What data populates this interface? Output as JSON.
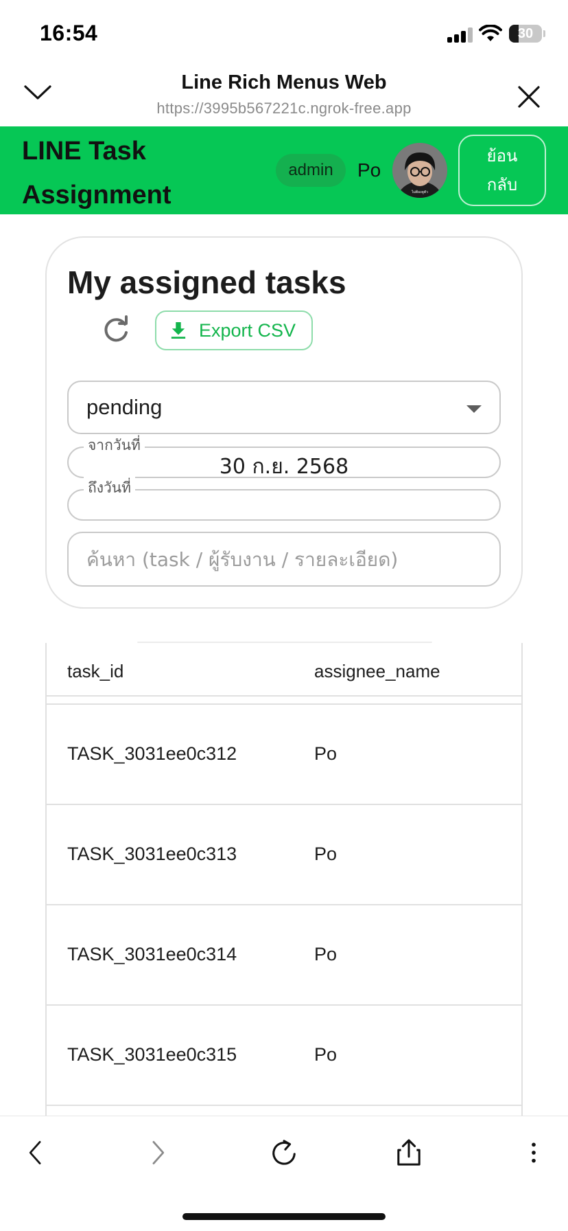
{
  "status_bar": {
    "time": "16:54",
    "battery_level": "30"
  },
  "browser": {
    "title": "Line Rich Menus Web",
    "url": "https://3995b567221c.ngrok-free.app"
  },
  "app_bar": {
    "title": "LINE Task Assignment",
    "role": "admin",
    "user_name": "Po",
    "avatar_caption": "ไม่ต้องดูตัว",
    "back_label": "ย้อนกลับ",
    "brand_color": "#06c755"
  },
  "filters": {
    "heading": "My assigned tasks",
    "export_label": "Export CSV",
    "status_value": "pending",
    "from_date_label": "จากวันที่",
    "from_date_value": "30 ก.ย. 2568",
    "to_date_label": "ถึงวันที่",
    "to_date_value": "",
    "search_placeholder": "ค้นหา (task / ผู้รับงาน / รายละเอียด)"
  },
  "table": {
    "columns": [
      "task_id",
      "assignee_name"
    ],
    "rows": [
      [
        "TASK_3031ee0c312",
        "Po"
      ],
      [
        "TASK_3031ee0c313",
        "Po"
      ],
      [
        "TASK_3031ee0c314",
        "Po"
      ],
      [
        "TASK_3031ee0c315",
        "Po"
      ]
    ]
  },
  "toolbar": {
    "icons": [
      "back-icon",
      "forward-icon",
      "reload-icon",
      "share-icon",
      "more-icon"
    ]
  }
}
